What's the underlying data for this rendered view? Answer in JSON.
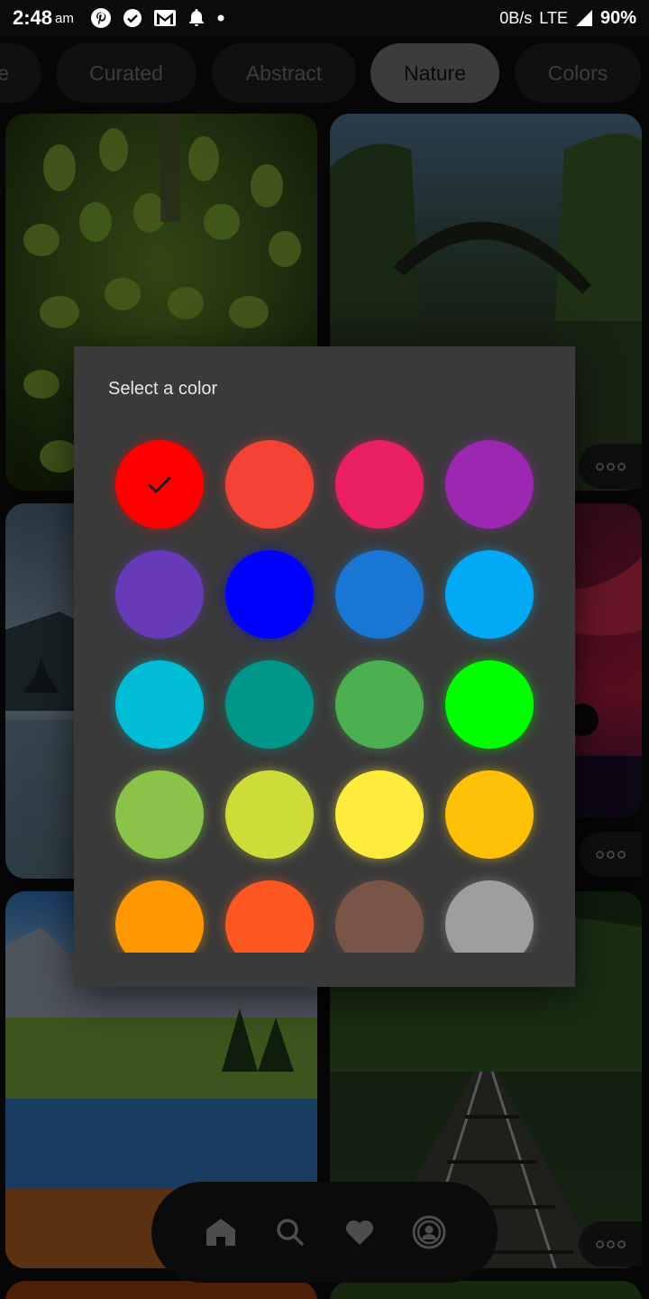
{
  "status_bar": {
    "time": "2:48",
    "ampm": "am",
    "network_speed": "0B/s",
    "network_type": "LTE",
    "battery": "90%"
  },
  "categories": [
    {
      "label": "e",
      "active": false
    },
    {
      "label": "Curated",
      "active": false
    },
    {
      "label": "Abstract",
      "active": false
    },
    {
      "label": "Nature",
      "active": true
    },
    {
      "label": "Colors",
      "active": false
    }
  ],
  "dialog": {
    "title": "Select a color",
    "selected_index": 0,
    "swatches": [
      {
        "name": "red",
        "color": "#ff0000"
      },
      {
        "name": "red-orange",
        "color": "#f44336"
      },
      {
        "name": "pink",
        "color": "#e91e63"
      },
      {
        "name": "purple",
        "color": "#9c27b0"
      },
      {
        "name": "deep-purple",
        "color": "#673ab7"
      },
      {
        "name": "blue",
        "color": "#0000ff"
      },
      {
        "name": "medium-blue",
        "color": "#1976d2"
      },
      {
        "name": "light-blue",
        "color": "#03a9f4"
      },
      {
        "name": "cyan",
        "color": "#00bcd4"
      },
      {
        "name": "teal",
        "color": "#009688"
      },
      {
        "name": "green",
        "color": "#4caf50"
      },
      {
        "name": "lime-green",
        "color": "#00ff00"
      },
      {
        "name": "light-green",
        "color": "#8bc34a"
      },
      {
        "name": "lime",
        "color": "#cddc39"
      },
      {
        "name": "yellow",
        "color": "#ffeb3b"
      },
      {
        "name": "amber",
        "color": "#ffc107"
      },
      {
        "name": "orange",
        "color": "#ff9800"
      },
      {
        "name": "deep-orange",
        "color": "#ff5722"
      },
      {
        "name": "brown",
        "color": "#795548"
      },
      {
        "name": "grey",
        "color": "#9e9e9e"
      }
    ]
  },
  "bottom_nav": [
    {
      "name": "home-icon"
    },
    {
      "name": "search-icon"
    },
    {
      "name": "heart-icon"
    },
    {
      "name": "profile-icon"
    }
  ]
}
